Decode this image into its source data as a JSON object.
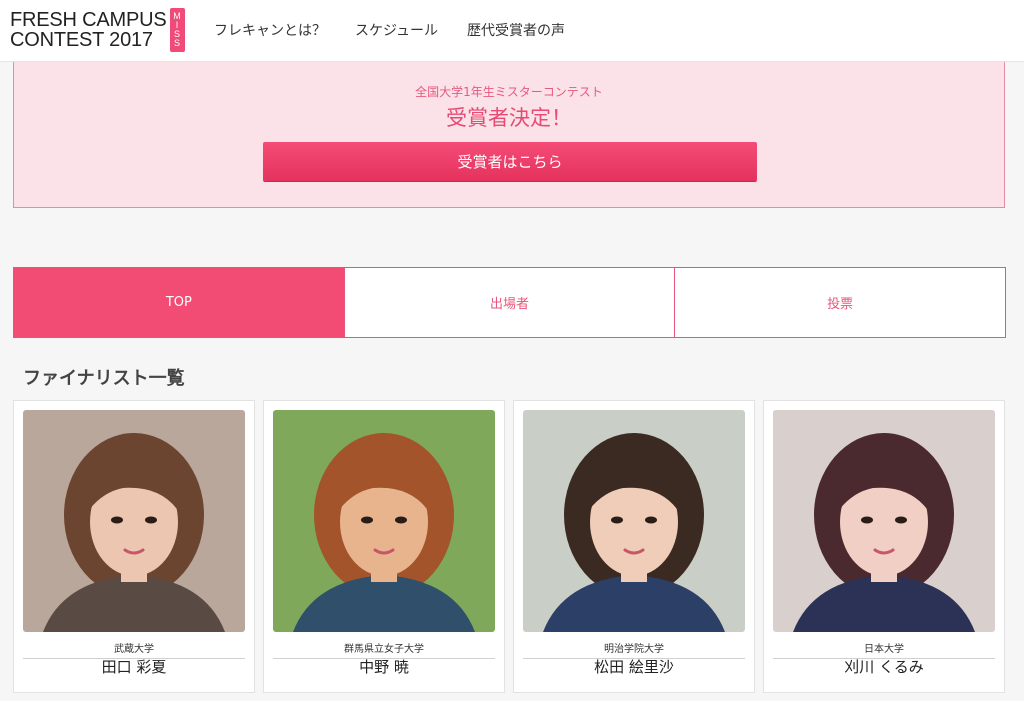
{
  "header": {
    "logo_line1": "FRESH CAMPUS",
    "logo_line2": "CONTEST 2017",
    "logo_badge": "MISS",
    "nav": [
      {
        "label": "フレキャンとは？"
      },
      {
        "label": "スケジュール"
      },
      {
        "label": "歴代受賞者の声"
      }
    ]
  },
  "banner": {
    "subtitle": "全国大学1年生ミスターコンテスト",
    "title": "受賞者決定！",
    "button_label": "受賞者はこちら"
  },
  "tabs": [
    {
      "label": "TOP",
      "active": true
    },
    {
      "label": "出場者",
      "active": false
    },
    {
      "label": "投票",
      "active": false
    }
  ],
  "section_title": "ファイナリスト一覧",
  "finalists": [
    {
      "university": "武蔵大学",
      "name": "田口 彩夏",
      "bg": "#b9a79b",
      "hair": "#6b4530",
      "skin": "#ecc6b0",
      "cloth": "#5a4a44"
    },
    {
      "university": "群馬県立女子大学",
      "name": "中野 暁",
      "bg": "#7fa85a",
      "hair": "#a3542a",
      "skin": "#e8b48e",
      "cloth": "#2f4f6a"
    },
    {
      "university": "明治学院大学",
      "name": "松田 絵里沙",
      "bg": "#c9cfc6",
      "hair": "#3b2a22",
      "skin": "#f0cdb8",
      "cloth": "#2c3f66"
    },
    {
      "university": "日本大学",
      "name": "刈川 くるみ",
      "bg": "#d9cfcc",
      "hair": "#4a2a2e",
      "skin": "#f1cfc4",
      "cloth": "#2b3256"
    }
  ],
  "colors": {
    "accent": "#f24c75",
    "banner_bg": "#fbe2e8"
  }
}
